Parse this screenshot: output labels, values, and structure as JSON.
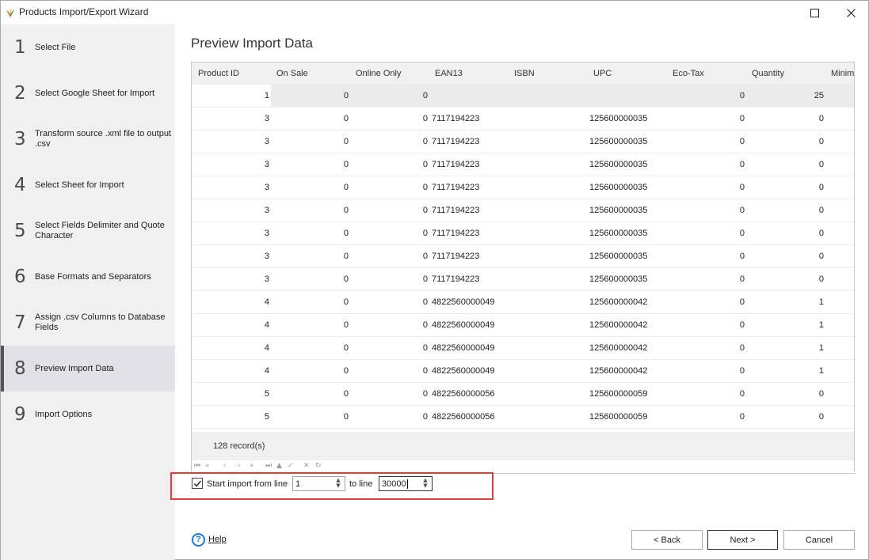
{
  "window": {
    "title": "Products Import/Export Wizard"
  },
  "steps": [
    {
      "num": "1",
      "label": "Select File"
    },
    {
      "num": "2",
      "label": "Select Google Sheet for Import"
    },
    {
      "num": "3",
      "label": "Transform source .xml file to output .csv"
    },
    {
      "num": "4",
      "label": "Select Sheet for Import"
    },
    {
      "num": "5",
      "label": "Select Fields Delimiter and Quote Character"
    },
    {
      "num": "6",
      "label": "Base Formats and Separators"
    },
    {
      "num": "7",
      "label": "Assign .csv Columns to Database Fields"
    },
    {
      "num": "8",
      "label": "Preview Import Data"
    },
    {
      "num": "9",
      "label": "Import Options"
    }
  ],
  "active_step": "8",
  "main": {
    "title": "Preview Import Data"
  },
  "grid": {
    "columns": [
      "Product ID",
      "On Sale",
      "Online Only",
      "EAN13",
      "ISBN",
      "UPC",
      "Eco-Tax",
      "Quantity",
      "Minim"
    ],
    "rows": [
      [
        "1",
        "0",
        "0",
        "",
        "",
        "",
        "",
        "0",
        "25"
      ],
      [
        "3",
        "0",
        "0",
        "7117194223",
        "",
        "125600000035",
        "",
        "0",
        "0"
      ],
      [
        "3",
        "0",
        "0",
        "7117194223",
        "",
        "125600000035",
        "",
        "0",
        "0"
      ],
      [
        "3",
        "0",
        "0",
        "7117194223",
        "",
        "125600000035",
        "",
        "0",
        "0"
      ],
      [
        "3",
        "0",
        "0",
        "7117194223",
        "",
        "125600000035",
        "",
        "0",
        "0"
      ],
      [
        "3",
        "0",
        "0",
        "7117194223",
        "",
        "125600000035",
        "",
        "0",
        "0"
      ],
      [
        "3",
        "0",
        "0",
        "7117194223",
        "",
        "125600000035",
        "",
        "0",
        "0"
      ],
      [
        "3",
        "0",
        "0",
        "7117194223",
        "",
        "125600000035",
        "",
        "0",
        "0"
      ],
      [
        "3",
        "0",
        "0",
        "7117194223",
        "",
        "125600000035",
        "",
        "0",
        "0"
      ],
      [
        "4",
        "0",
        "0",
        "4822560000049",
        "",
        "125600000042",
        "",
        "0",
        "1"
      ],
      [
        "4",
        "0",
        "0",
        "4822560000049",
        "",
        "125600000042",
        "",
        "0",
        "1"
      ],
      [
        "4",
        "0",
        "0",
        "4822560000049",
        "",
        "125600000042",
        "",
        "0",
        "1"
      ],
      [
        "4",
        "0",
        "0",
        "4822560000049",
        "",
        "125600000042",
        "",
        "0",
        "1"
      ],
      [
        "5",
        "0",
        "0",
        "4822560000056",
        "",
        "125600000059",
        "",
        "0",
        "0"
      ],
      [
        "5",
        "0",
        "0",
        "4822560000056",
        "",
        "125600000059",
        "",
        "0",
        "0"
      ]
    ],
    "records_label": "128 record(s)",
    "nav_icons": [
      "first-icon",
      "prev-page-icon",
      "prev-icon",
      "next-icon",
      "next-page-icon",
      "last-icon",
      "insert-icon",
      "delete-icon",
      "check-icon",
      "cancel-icon",
      "refresh-icon"
    ]
  },
  "import_range": {
    "checkbox_checked": true,
    "start_label": "Start import from line",
    "start_value": "1",
    "to_label": "to line",
    "end_value": "30000",
    "highlight_color": "#e8393b"
  },
  "footer": {
    "help_label": "Help",
    "back_label": "< Back",
    "next_label": "Next >",
    "cancel_label": "Cancel"
  }
}
